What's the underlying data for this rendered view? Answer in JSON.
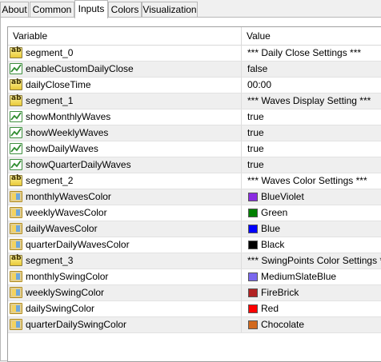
{
  "tabs": [
    {
      "label": "About",
      "active": false
    },
    {
      "label": "Common",
      "active": false
    },
    {
      "label": "Inputs",
      "active": true
    },
    {
      "label": "Colors",
      "active": false
    },
    {
      "label": "Visualization",
      "active": false
    }
  ],
  "table": {
    "columns": {
      "variable": "Variable",
      "value": "Value"
    },
    "rows": [
      {
        "type": "string",
        "name": "segment_0",
        "value": "*** Daily Close Settings ***"
      },
      {
        "type": "bool",
        "name": "enableCustomDailyClose",
        "value": "false"
      },
      {
        "type": "string",
        "name": "dailyCloseTime",
        "value": "00:00"
      },
      {
        "type": "string",
        "name": "segment_1",
        "value": "*** Waves Display Setting ***"
      },
      {
        "type": "bool",
        "name": "showMonthlyWaves",
        "value": "true"
      },
      {
        "type": "bool",
        "name": "showWeeklyWaves",
        "value": "true"
      },
      {
        "type": "bool",
        "name": "showDailyWaves",
        "value": "true"
      },
      {
        "type": "bool",
        "name": "showQuarterDailyWaves",
        "value": "true"
      },
      {
        "type": "string",
        "name": "segment_2",
        "value": "*** Waves Color Settings ***"
      },
      {
        "type": "color",
        "name": "monthlyWavesColor",
        "value": "BlueViolet",
        "color": "#8a2be2"
      },
      {
        "type": "color",
        "name": "weeklyWavesColor",
        "value": "Green",
        "color": "#008000"
      },
      {
        "type": "color",
        "name": "dailyWavesColor",
        "value": "Blue",
        "color": "#0000ff"
      },
      {
        "type": "color",
        "name": "quarterDailyWavesColor",
        "value": "Black",
        "color": "#000000"
      },
      {
        "type": "string",
        "name": "segment_3",
        "value": "*** SwingPoints Color Settings ***"
      },
      {
        "type": "color",
        "name": "monthlySwingColor",
        "value": "MediumSlateBlue",
        "color": "#7b68ee"
      },
      {
        "type": "color",
        "name": "weeklySwingColor",
        "value": "FireBrick",
        "color": "#b22222"
      },
      {
        "type": "color",
        "name": "dailySwingColor",
        "value": "Red",
        "color": "#ff0000"
      },
      {
        "type": "color",
        "name": "quarterDailySwingColor",
        "value": "Chocolate",
        "color": "#d2691e"
      }
    ]
  },
  "icons": {
    "string": "ab-string-icon",
    "bool": "bool-toggle-icon",
    "color": "color-palette-icon"
  },
  "icon_text": {
    "string": "ab"
  }
}
